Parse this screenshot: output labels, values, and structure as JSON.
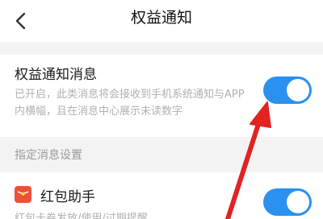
{
  "header": {
    "title": "权益通知"
  },
  "benefit_notification": {
    "title": "权益通知消息",
    "description": "已开启，此类消息将会接收到手机系统通知与APP内横幅，且在消息中心展示未读数字",
    "enabled": true
  },
  "specific_settings": {
    "section_label": "指定消息设置",
    "items": [
      {
        "title": "红包助手",
        "description": "红包卡券发放/使用/过期提醒",
        "enabled": true,
        "icon": "red-packet-icon"
      }
    ]
  },
  "colors": {
    "toggle_on": "#2a91ee",
    "annotation_arrow": "#e32222",
    "icon_red": "#f0503a"
  }
}
